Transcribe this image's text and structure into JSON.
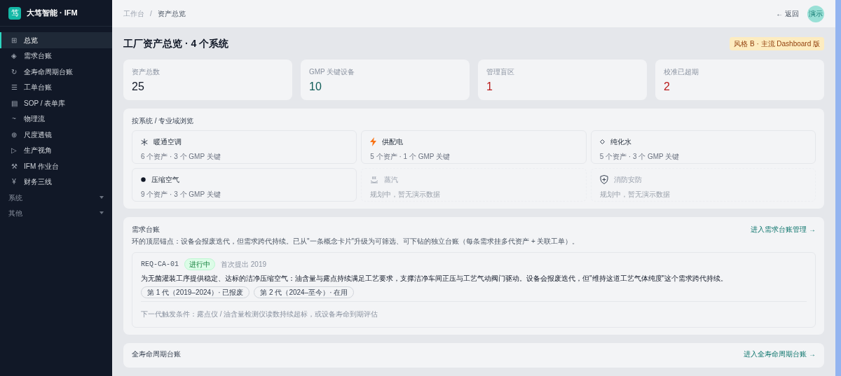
{
  "brand": {
    "logo": "笃",
    "name": "大笃智能 · IFM"
  },
  "sidebar": {
    "items": [
      {
        "icon": "⊞",
        "label": "总览",
        "selected": true
      },
      {
        "icon": "◈",
        "label": "需求台账",
        "selected": false
      },
      {
        "icon": "↻",
        "label": "全寿命周期台账",
        "selected": false
      },
      {
        "icon": "☰",
        "label": "工单台账",
        "selected": false
      },
      {
        "icon": "▤",
        "label": "SOP / 表单库",
        "selected": false
      },
      {
        "icon": "~",
        "label": "物理流",
        "selected": false
      },
      {
        "icon": "⊕",
        "label": "尺度透镜",
        "selected": false
      },
      {
        "icon": "▷",
        "label": "生产视角",
        "selected": false
      },
      {
        "icon": "⚒",
        "label": "IFM 作业台",
        "selected": false
      },
      {
        "icon": "¥",
        "label": "财务三线",
        "selected": false
      }
    ],
    "groups": [
      {
        "label": "系统",
        "expanded": false
      },
      {
        "label": "其他",
        "expanded": false
      }
    ]
  },
  "breadcrumb": [
    "工作台",
    "资产总览"
  ],
  "breadcrumb_separator": "/",
  "back_link": "← 返回",
  "avatar": "演示",
  "page_title": "工厂资产总览 · 4 个系统",
  "style_badge": "风格 B · 主流 Dashboard 版",
  "stats": [
    {
      "label": "资产总数",
      "value": "25",
      "kind": "normal"
    },
    {
      "label": "GMP 关键设备",
      "value": "10",
      "kind": "good"
    },
    {
      "label": "管理盲区",
      "value": "1",
      "kind": "danger"
    },
    {
      "label": "校准已超期",
      "value": "2",
      "kind": "danger"
    }
  ],
  "systems": {
    "title": "按系统 / 专业域浏览",
    "items": [
      {
        "kind": "hvac",
        "name": "暖通空调",
        "detail": "6 个资产 · 3 个 GMP 关键",
        "disabled": false
      },
      {
        "kind": "power",
        "name": "供配电",
        "detail": "5 个资产 · 1 个 GMP 关键",
        "disabled": false
      },
      {
        "kind": "water",
        "name": "纯化水",
        "detail": "5 个资产 · 3 个 GMP 关键",
        "disabled": false
      },
      {
        "kind": "air",
        "name": "压缩空气",
        "detail": "9 个资产 · 3 个 GMP 关键",
        "disabled": false
      },
      {
        "kind": "steam",
        "name": "蒸汽",
        "detail": "规划中，暂无演示数据",
        "disabled": true
      },
      {
        "kind": "fire",
        "name": "消防安防",
        "detail": "规划中，暂无演示数据",
        "disabled": true
      }
    ]
  },
  "requirements": {
    "title": "需求台账",
    "subtitle": "环的顶层锚点：设备会报废迭代，但需求跨代持续。已从\"一条概念卡片\"升级为可筛选、可下钻的独立台账（每条需求挂多代资产 + 关联工单）。",
    "link": "进入需求台账管理 →",
    "card": {
      "id": "REQ-CA-01",
      "status": "进行中",
      "since": "首次提出 2019",
      "text": "为无菌灌装工序提供稳定、达标的洁净压缩空气：油含量与露点持续满足工艺要求，支撑洁净车间正压与工艺气动阀门驱动。设备会报废迭代，但\"维持这道工艺气体纯度\"这个需求跨代持续。",
      "generations": [
        "第 1 代（2019–2024）· 已报废",
        "第 2 代（2024–至今）· 在用"
      ],
      "trigger": "下一代触发条件：露点仪 / 油含量检测仪读数持续超标，或设备寿命到期评估"
    }
  },
  "lifecycle": {
    "title": "全寿命周期台账",
    "link": "进入全寿命周期台账 →"
  }
}
